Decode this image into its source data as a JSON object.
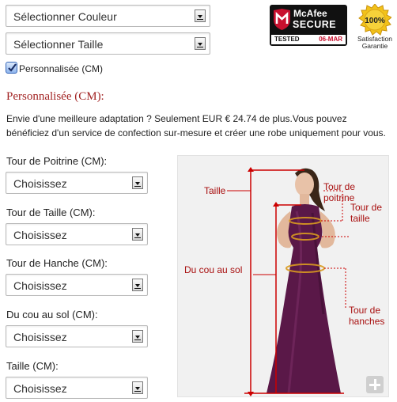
{
  "selects": {
    "color": "Sélectionner Couleur",
    "size": "Sélectionner Taille"
  },
  "custom": {
    "checkbox_label": "Personnalisée (CM)",
    "checked": true,
    "title": "Personnalisée (CM):",
    "intro": "Envie d'une meilleure adaptation ? Seulement EUR € 24.74 de plus.Vous pouvez bénéficiez d'un service de confection sur-mesure et créer une robe uniquement pour vous."
  },
  "fields": [
    {
      "label": "Tour de Poitrine (CM):",
      "value": "Choisissez"
    },
    {
      "label": "Tour de Taille (CM):",
      "value": "Choisissez"
    },
    {
      "label": "Tour de Hanche (CM):",
      "value": "Choisissez"
    },
    {
      "label": "Du cou au sol (CM):",
      "value": "Choisissez"
    },
    {
      "label": "Taille (CM):",
      "value": "Choisissez"
    }
  ],
  "mcafee": {
    "brand": "McAfee",
    "secure": "SECURE",
    "tested": "TESTED",
    "date": "06-MAR"
  },
  "seal": {
    "percent": "100%",
    "line1": "Satisfaction",
    "line2": "Garantie"
  },
  "diagram": {
    "taille": "Taille",
    "poitrine": "Tour de poitrine",
    "tour_taille_1": "Tour de",
    "tour_taille_2": "taille",
    "cou_sol": "Du cou au sol",
    "hanches_1": "Tour de",
    "hanches_2": "hanches"
  },
  "colors": {
    "accent_red": "#a22323",
    "dress_purple": "#5a1848",
    "checkbox_blue": "#3566b8"
  }
}
